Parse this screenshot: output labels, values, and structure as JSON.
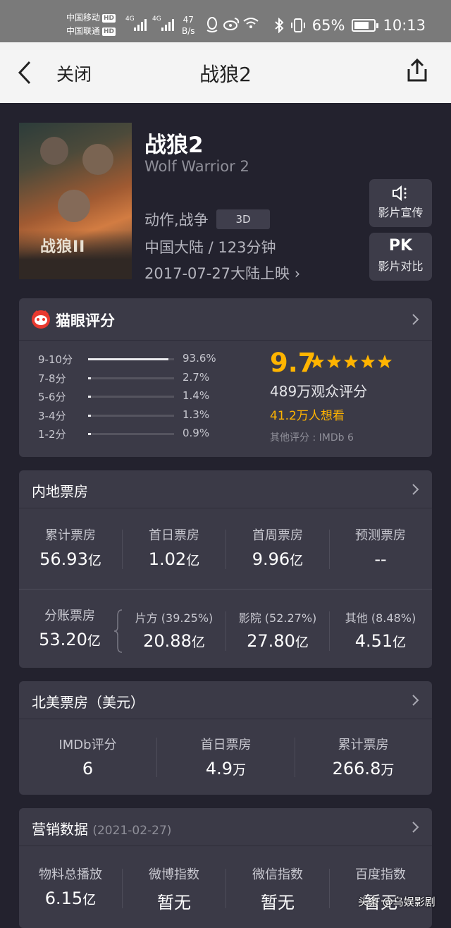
{
  "status_bar": {
    "carrier1": "中国移动",
    "carrier2": "中国联通",
    "hd": "HD",
    "network1": "4G",
    "network2": "4G",
    "speed_value": "47",
    "speed_unit": "B/s",
    "battery": "65%",
    "time": "10:13"
  },
  "nav": {
    "close_label": "关闭",
    "title": "战狼2"
  },
  "movie": {
    "title": "战狼2",
    "english_title": "Wolf Warrior 2",
    "genre": "动作,战争",
    "format_badge": "3D",
    "meta": "中国大陆 / 123分钟",
    "release": "2017-07-27大陆上映",
    "poster_logo": "战狼II",
    "trailer_label": "影片宣传",
    "pk_icon_text": "PK",
    "compare_label": "影片对比"
  },
  "maoyan_rating": {
    "title": "猫眼评分",
    "distribution": [
      {
        "range": "9-10分",
        "pct_label": "93.6%",
        "pct": 93.6
      },
      {
        "range": "7-8分",
        "pct_label": "2.7%",
        "pct": 2.7
      },
      {
        "range": "5-6分",
        "pct_label": "1.4%",
        "pct": 1.4
      },
      {
        "range": "3-4分",
        "pct_label": "1.3%",
        "pct": 1.3
      },
      {
        "range": "1-2分",
        "pct_label": "0.9%",
        "pct": 0.9
      }
    ],
    "score": "9.7",
    "stars": 5,
    "viewers": "489万观众评分",
    "wants": "41.2万人想看",
    "other": "其他评分 : IMDb 6"
  },
  "mainland_box": {
    "title": "内地票房",
    "row1": [
      {
        "label": "累计票房",
        "value": "56.93",
        "unit": "亿"
      },
      {
        "label": "首日票房",
        "value": "1.02",
        "unit": "亿"
      },
      {
        "label": "首周票房",
        "value": "9.96",
        "unit": "亿"
      },
      {
        "label": "预测票房",
        "value": "--",
        "unit": ""
      }
    ],
    "split_label": "分账票房",
    "split_value": "53.20",
    "split_unit": "亿",
    "row2": [
      {
        "label": "片方 (39.25%)",
        "value": "20.88",
        "unit": "亿"
      },
      {
        "label": "影院 (52.27%)",
        "value": "27.80",
        "unit": "亿"
      },
      {
        "label": "其他 (8.48%)",
        "value": "4.51",
        "unit": "亿"
      }
    ]
  },
  "na_box": {
    "title": "北美票房（美元）",
    "items": [
      {
        "label": "IMDb评分",
        "value": "6",
        "unit": ""
      },
      {
        "label": "首日票房",
        "value": "4.9",
        "unit": "万"
      },
      {
        "label": "累计票房",
        "value": "266.8",
        "unit": "万"
      }
    ]
  },
  "marketing": {
    "title": "营销数据",
    "date": "(2021-02-27)",
    "items": [
      {
        "label": "物料总播放",
        "value": "6.15",
        "unit": "亿"
      },
      {
        "label": "微博指数",
        "value": "暂无",
        "unit": ""
      },
      {
        "label": "微信指数",
        "value": "暂无",
        "unit": ""
      },
      {
        "label": "百度指数",
        "value": "暂无",
        "unit": ""
      }
    ]
  },
  "watermark": "头条 @乌娱影剧",
  "colors": {
    "background": "#23222e",
    "card": "#3b3a47",
    "accent": "#ffb400",
    "nav_bg": "#f4f4f4"
  }
}
